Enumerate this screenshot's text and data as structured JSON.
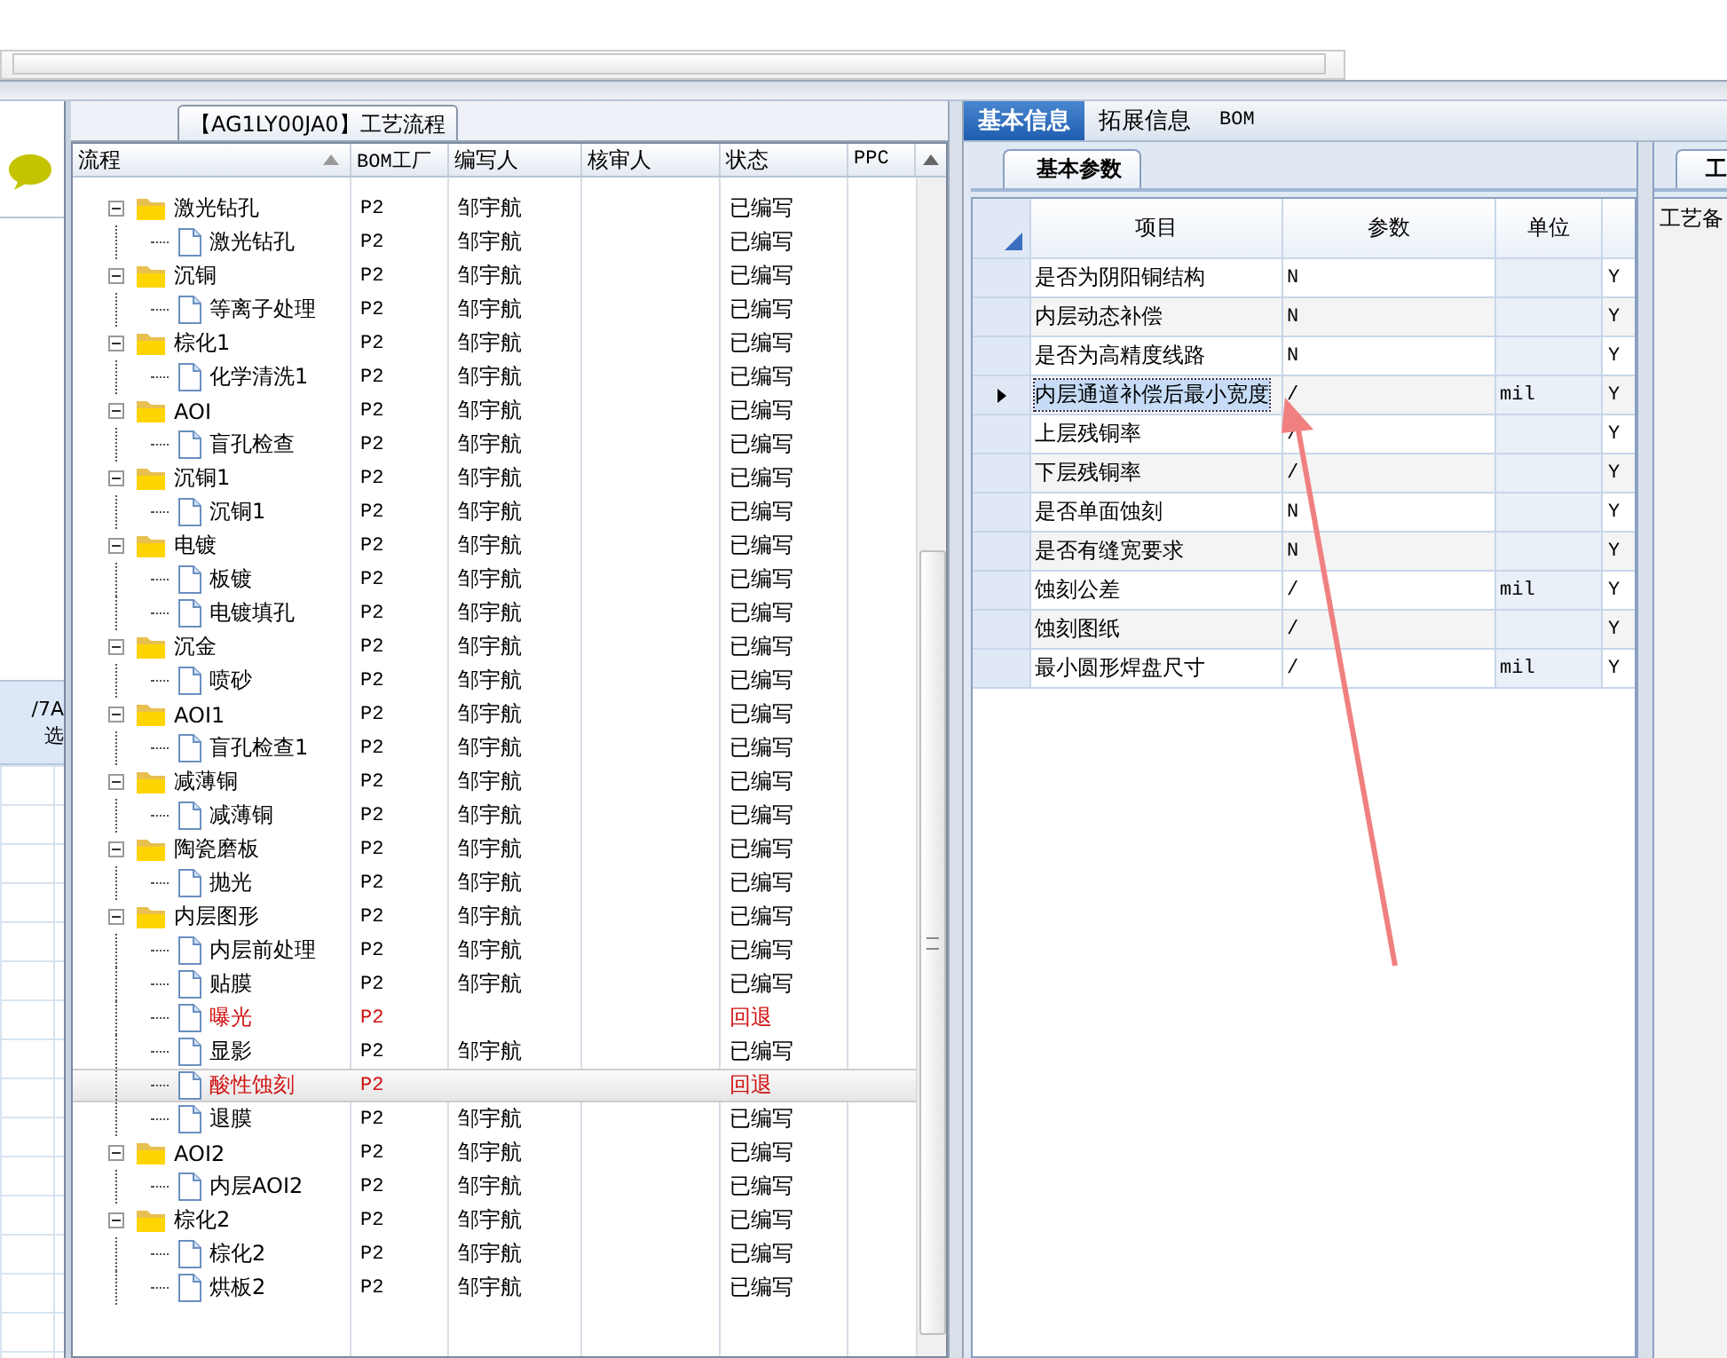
{
  "left_panel": {
    "texts": [
      "/7A",
      "选"
    ]
  },
  "flow_panel": {
    "title": "【AG1LY00JA0】工艺流程",
    "columns": [
      "流程",
      "BOM工厂",
      "编写人",
      "核审人",
      "状态",
      "PPC"
    ],
    "tree": [
      {
        "name": "激光钻孔",
        "factory": "P2",
        "writer": "邹宇航",
        "status": "已编写",
        "returned": false,
        "selected": false,
        "expanded": true,
        "children": [
          {
            "name": "激光钻孔",
            "factory": "P2",
            "writer": "邹宇航",
            "status": "已编写",
            "returned": false,
            "selected": false
          }
        ]
      },
      {
        "name": "沉铜",
        "factory": "P2",
        "writer": "邹宇航",
        "status": "已编写",
        "returned": false,
        "selected": false,
        "expanded": true,
        "children": [
          {
            "name": "等离子处理",
            "factory": "P2",
            "writer": "邹宇航",
            "status": "已编写",
            "returned": false,
            "selected": false
          }
        ]
      },
      {
        "name": "棕化1",
        "factory": "P2",
        "writer": "邹宇航",
        "status": "已编写",
        "returned": false,
        "selected": false,
        "expanded": true,
        "children": [
          {
            "name": "化学清洗1",
            "factory": "P2",
            "writer": "邹宇航",
            "status": "已编写",
            "returned": false,
            "selected": false
          }
        ]
      },
      {
        "name": "AOI",
        "factory": "P2",
        "writer": "邹宇航",
        "status": "已编写",
        "returned": false,
        "selected": false,
        "expanded": true,
        "children": [
          {
            "name": "盲孔检查",
            "factory": "P2",
            "writer": "邹宇航",
            "status": "已编写",
            "returned": false,
            "selected": false
          }
        ]
      },
      {
        "name": "沉铜1",
        "factory": "P2",
        "writer": "邹宇航",
        "status": "已编写",
        "returned": false,
        "selected": false,
        "expanded": true,
        "children": [
          {
            "name": "沉铜1",
            "factory": "P2",
            "writer": "邹宇航",
            "status": "已编写",
            "returned": false,
            "selected": false
          }
        ]
      },
      {
        "name": "电镀",
        "factory": "P2",
        "writer": "邹宇航",
        "status": "已编写",
        "returned": false,
        "selected": false,
        "expanded": true,
        "children": [
          {
            "name": "板镀",
            "factory": "P2",
            "writer": "邹宇航",
            "status": "已编写",
            "returned": false,
            "selected": false
          },
          {
            "name": "电镀填孔",
            "factory": "P2",
            "writer": "邹宇航",
            "status": "已编写",
            "returned": false,
            "selected": false
          }
        ]
      },
      {
        "name": "沉金",
        "factory": "P2",
        "writer": "邹宇航",
        "status": "已编写",
        "returned": false,
        "selected": false,
        "expanded": true,
        "children": [
          {
            "name": "喷砂",
            "factory": "P2",
            "writer": "邹宇航",
            "status": "已编写",
            "returned": false,
            "selected": false
          }
        ]
      },
      {
        "name": "AOI1",
        "factory": "P2",
        "writer": "邹宇航",
        "status": "已编写",
        "returned": false,
        "selected": false,
        "expanded": true,
        "children": [
          {
            "name": "盲孔检查1",
            "factory": "P2",
            "writer": "邹宇航",
            "status": "已编写",
            "returned": false,
            "selected": false
          }
        ]
      },
      {
        "name": "减薄铜",
        "factory": "P2",
        "writer": "邹宇航",
        "status": "已编写",
        "returned": false,
        "selected": false,
        "expanded": true,
        "children": [
          {
            "name": "减薄铜",
            "factory": "P2",
            "writer": "邹宇航",
            "status": "已编写",
            "returned": false,
            "selected": false
          }
        ]
      },
      {
        "name": "陶瓷磨板",
        "factory": "P2",
        "writer": "邹宇航",
        "status": "已编写",
        "returned": false,
        "selected": false,
        "expanded": true,
        "children": [
          {
            "name": "抛光",
            "factory": "P2",
            "writer": "邹宇航",
            "status": "已编写",
            "returned": false,
            "selected": false
          }
        ]
      },
      {
        "name": "内层图形",
        "factory": "P2",
        "writer": "邹宇航",
        "status": "已编写",
        "returned": false,
        "selected": false,
        "expanded": true,
        "children": [
          {
            "name": "内层前处理",
            "factory": "P2",
            "writer": "邹宇航",
            "status": "已编写",
            "returned": false,
            "selected": false
          },
          {
            "name": "贴膜",
            "factory": "P2",
            "writer": "邹宇航",
            "status": "已编写",
            "returned": false,
            "selected": false
          },
          {
            "name": "曝光",
            "factory": "P2",
            "status": "回退",
            "returned": true,
            "selected": false
          },
          {
            "name": "显影",
            "factory": "P2",
            "writer": "邹宇航",
            "status": "已编写",
            "returned": false,
            "selected": false
          },
          {
            "name": "酸性蚀刻",
            "factory": "P2",
            "status": "回退",
            "returned": true,
            "selected": true
          },
          {
            "name": "退膜",
            "factory": "P2",
            "writer": "邹宇航",
            "status": "已编写",
            "returned": false,
            "selected": false
          }
        ]
      },
      {
        "name": "AOI2",
        "factory": "P2",
        "writer": "邹宇航",
        "status": "已编写",
        "returned": false,
        "selected": false,
        "expanded": true,
        "children": [
          {
            "name": "内层AOI2",
            "factory": "P2",
            "writer": "邹宇航",
            "status": "已编写",
            "returned": false,
            "selected": false
          }
        ]
      },
      {
        "name": "棕化2",
        "factory": "P2",
        "writer": "邹宇航",
        "status": "已编写",
        "returned": false,
        "selected": false,
        "expanded": true,
        "children": [
          {
            "name": "棕化2",
            "factory": "P2",
            "writer": "邹宇航",
            "status": "已编写",
            "returned": false,
            "selected": false
          },
          {
            "name": "烘板2",
            "factory": "P2",
            "writer": "邹宇航",
            "status": "已编写",
            "returned": false,
            "selected": false
          }
        ]
      }
    ]
  },
  "info_panel": {
    "tabs": [
      {
        "label": "基本信息",
        "selected": true
      },
      {
        "label": "拓展信息",
        "selected": false
      },
      {
        "label": "BOM",
        "selected": false
      }
    ],
    "subtab": "基本参数",
    "columns": [
      "项目",
      "参数",
      "单位"
    ],
    "rows": [
      {
        "item": "是否为阴阳铜结构",
        "param": "N",
        "flag": "Y",
        "selected": false
      },
      {
        "item": "内层动态补偿",
        "param": "N",
        "flag": "Y",
        "selected": false
      },
      {
        "item": "是否为高精度线路",
        "param": "N",
        "flag": "Y",
        "selected": false
      },
      {
        "item": "内层通道补偿后最小宽度",
        "param": "/",
        "unit": "mil",
        "flag": "Y",
        "selected": true
      },
      {
        "item": "上层残铜率",
        "param": "/",
        "flag": "Y",
        "selected": false
      },
      {
        "item": "下层残铜率",
        "param": "/",
        "flag": "Y",
        "selected": false
      },
      {
        "item": "是否单面蚀刻",
        "param": "N",
        "flag": "Y",
        "selected": false
      },
      {
        "item": "是否有缝宽要求",
        "param": "N",
        "flag": "Y",
        "selected": false
      },
      {
        "item": "蚀刻公差",
        "param": "/",
        "unit": "mil",
        "flag": "Y",
        "selected": false
      },
      {
        "item": "蚀刻图纸",
        "param": "/",
        "flag": "Y",
        "selected": false
      },
      {
        "item": "最小圆形焊盘尺寸",
        "param": "/",
        "unit": "mil",
        "flag": "Y",
        "selected": false
      }
    ]
  },
  "notes_panel": {
    "tab": "工",
    "label": "工艺备"
  }
}
